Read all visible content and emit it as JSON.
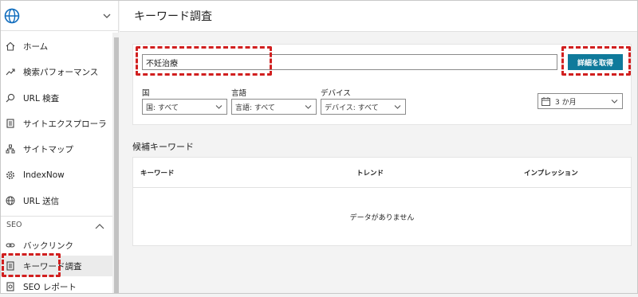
{
  "header": {
    "title": "キーワード調査"
  },
  "sidebar": {
    "items": [
      {
        "label": "ホーム",
        "icon": "home-icon"
      },
      {
        "label": "検索パフォーマンス",
        "icon": "trend-icon"
      },
      {
        "label": "URL 検査",
        "icon": "search-icon"
      },
      {
        "label": "サイトエクスプローラ",
        "icon": "document-icon"
      },
      {
        "label": "サイトマップ",
        "icon": "sitemap-icon"
      },
      {
        "label": "IndexNow",
        "icon": "gear-icon"
      },
      {
        "label": "URL 送信",
        "icon": "globe-icon"
      }
    ],
    "section": {
      "label": "SEO"
    },
    "seo_items": [
      {
        "label": "バックリンク",
        "icon": "link-icon"
      },
      {
        "label": "キーワード調査",
        "icon": "document-icon",
        "active": true
      },
      {
        "label": "SEO レポート",
        "icon": "report-icon"
      }
    ]
  },
  "search": {
    "value": "不妊治療",
    "button": "詳細を取得"
  },
  "filters": {
    "country": {
      "label": "国",
      "value": "国: すべて"
    },
    "language": {
      "label": "言語",
      "value": "言語: すべて"
    },
    "device": {
      "label": "デバイス",
      "value": "デバイス: すべて"
    },
    "period": {
      "value": "3 か月"
    }
  },
  "results": {
    "title": "候補キーワード",
    "columns": [
      "キーワード",
      "トレンド",
      "インプレッション"
    ],
    "empty": "データがありません"
  },
  "colors": {
    "accent": "#0f7a9b",
    "highlight": "#d11f1f",
    "brand": "#0f6cbd"
  }
}
